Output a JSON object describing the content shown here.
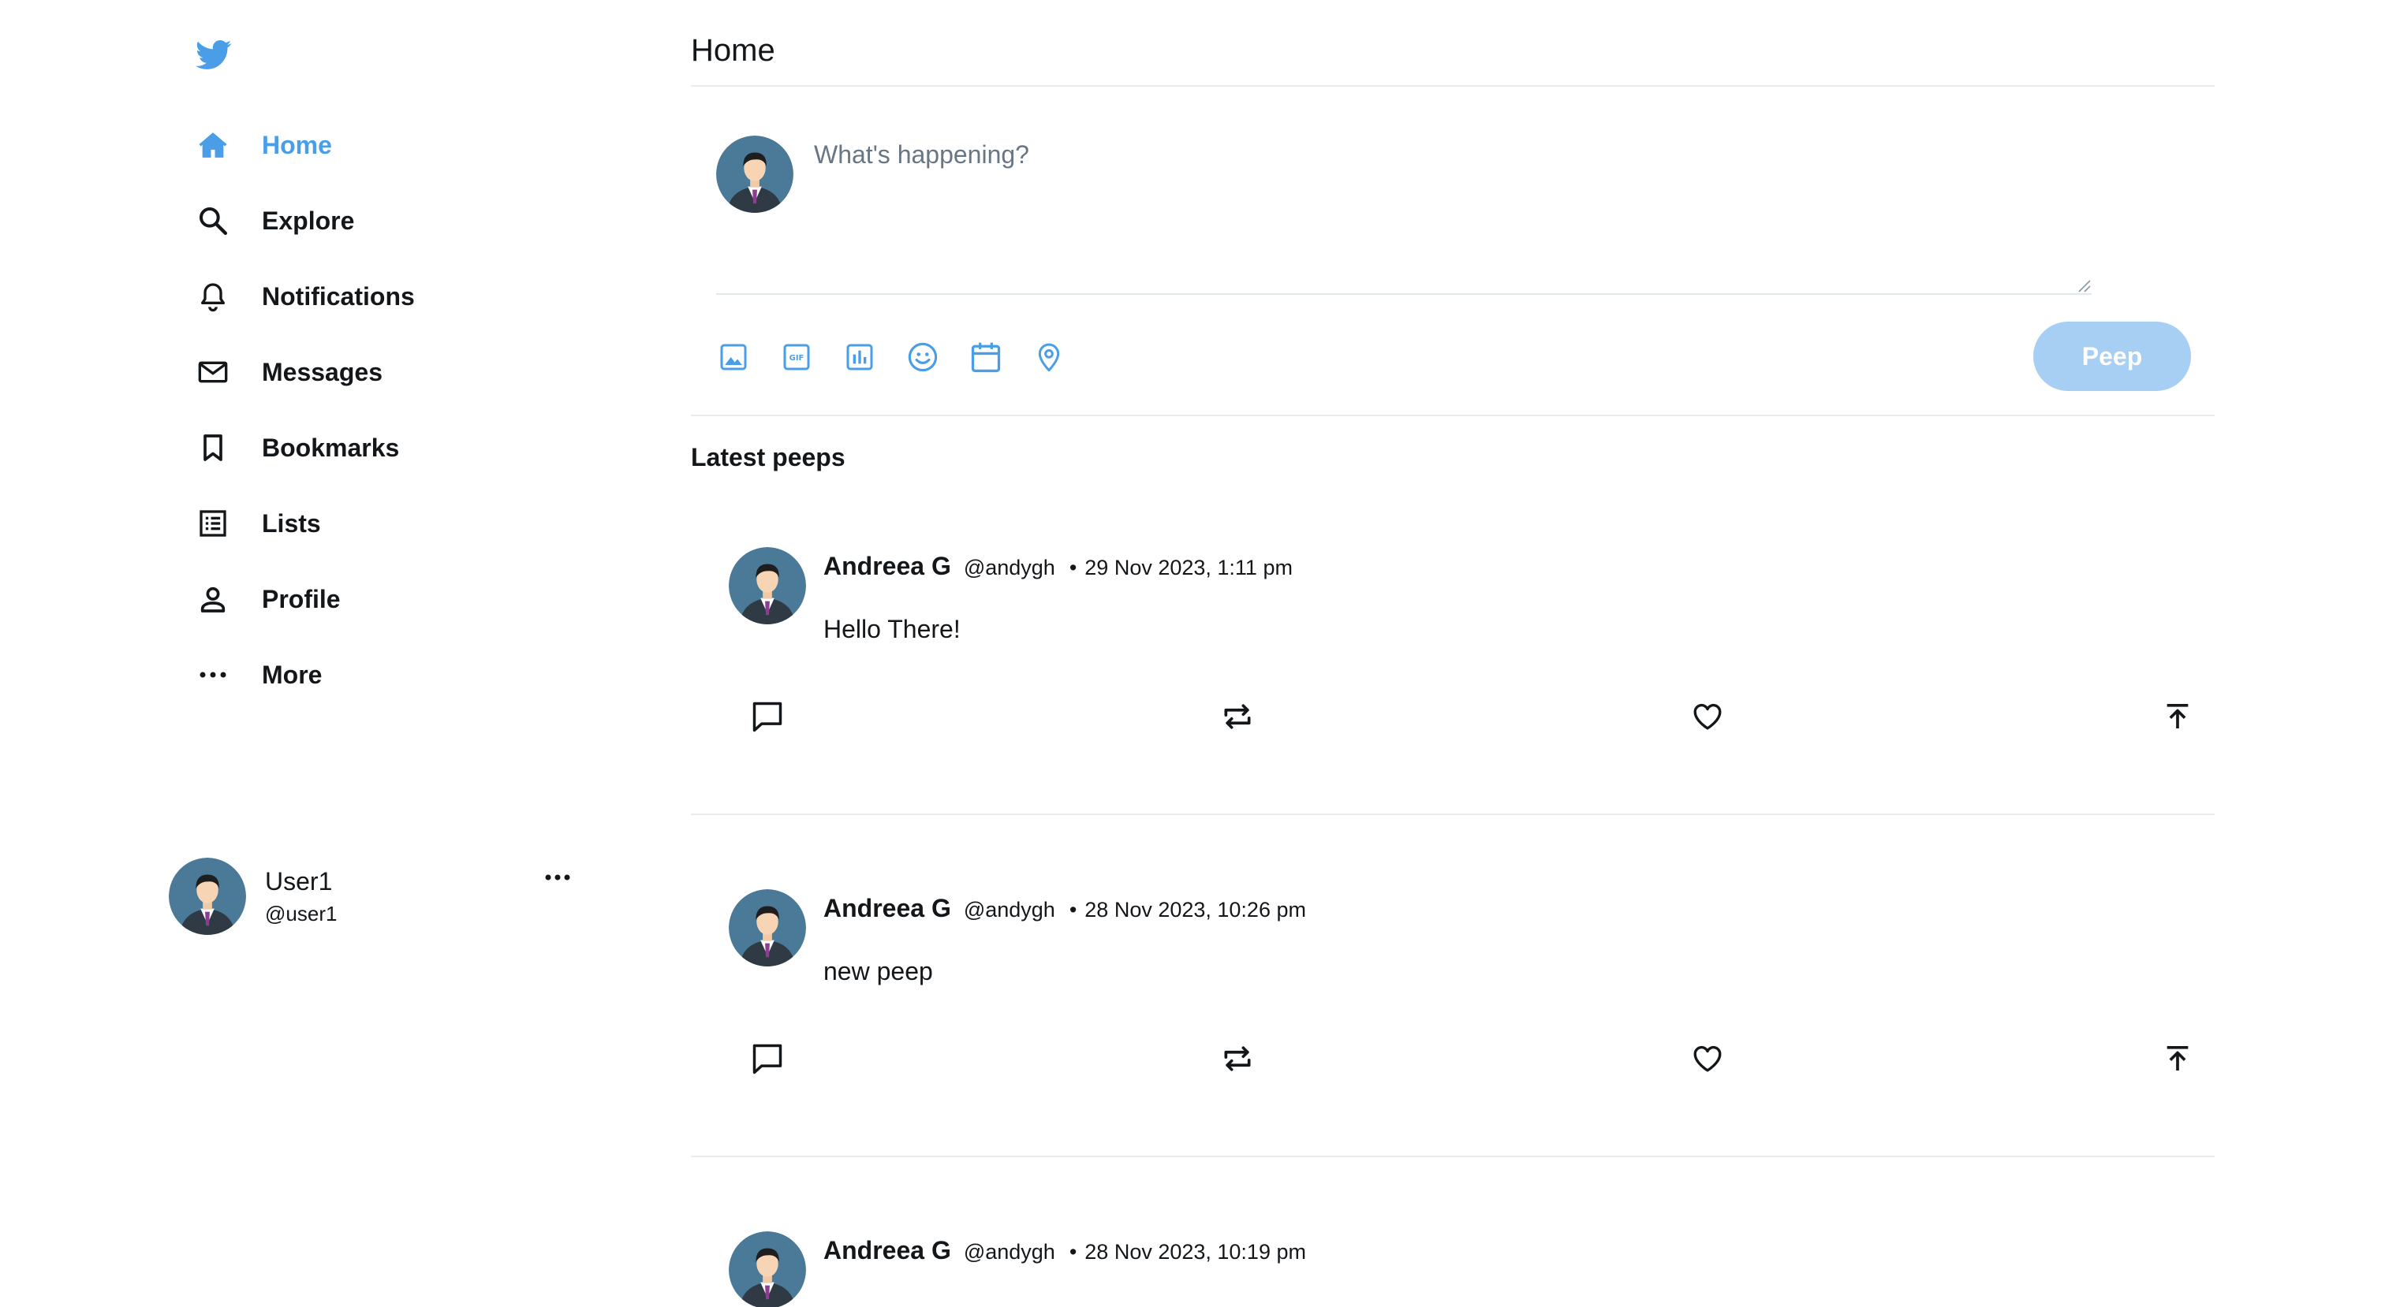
{
  "brand": {
    "logo_icon": "bird-icon",
    "accent": "#4a9ee8"
  },
  "sidebar": {
    "items": [
      {
        "label": "Home",
        "icon": "home-icon",
        "active": true
      },
      {
        "label": "Explore",
        "icon": "search-icon",
        "active": false
      },
      {
        "label": "Notifications",
        "icon": "bell-icon",
        "active": false
      },
      {
        "label": "Messages",
        "icon": "envelope-icon",
        "active": false
      },
      {
        "label": "Bookmarks",
        "icon": "bookmark-icon",
        "active": false
      },
      {
        "label": "Lists",
        "icon": "list-icon",
        "active": false
      },
      {
        "label": "Profile",
        "icon": "person-icon",
        "active": false
      },
      {
        "label": "More",
        "icon": "more-dots-icon",
        "active": false
      }
    ],
    "user": {
      "name": "User1",
      "handle": "@user1",
      "menu_icon": "more-dots-icon"
    }
  },
  "header": {
    "title": "Home"
  },
  "compose": {
    "placeholder": "What's happening?",
    "value": "",
    "tools": [
      "image-icon",
      "gif-icon",
      "poll-icon",
      "emoji-icon",
      "schedule-icon",
      "location-icon"
    ],
    "submit_label": "Peep",
    "submit_enabled": false
  },
  "feed": {
    "title": "Latest peeps",
    "peeps": [
      {
        "name": "Andreea G",
        "handle": "@andygh",
        "separator": "•",
        "date": "29 Nov 2023, 1:11 pm",
        "text": "Hello There!"
      },
      {
        "name": "Andreea G",
        "handle": "@andygh",
        "separator": "•",
        "date": "28 Nov 2023, 10:26 pm",
        "text": "new peep"
      },
      {
        "name": "Andreea G",
        "handle": "@andygh",
        "separator": "•",
        "date": "28 Nov 2023, 10:19 pm",
        "text": ""
      }
    ],
    "actions": [
      "reply-icon",
      "repost-icon",
      "like-icon",
      "share-icon"
    ]
  }
}
